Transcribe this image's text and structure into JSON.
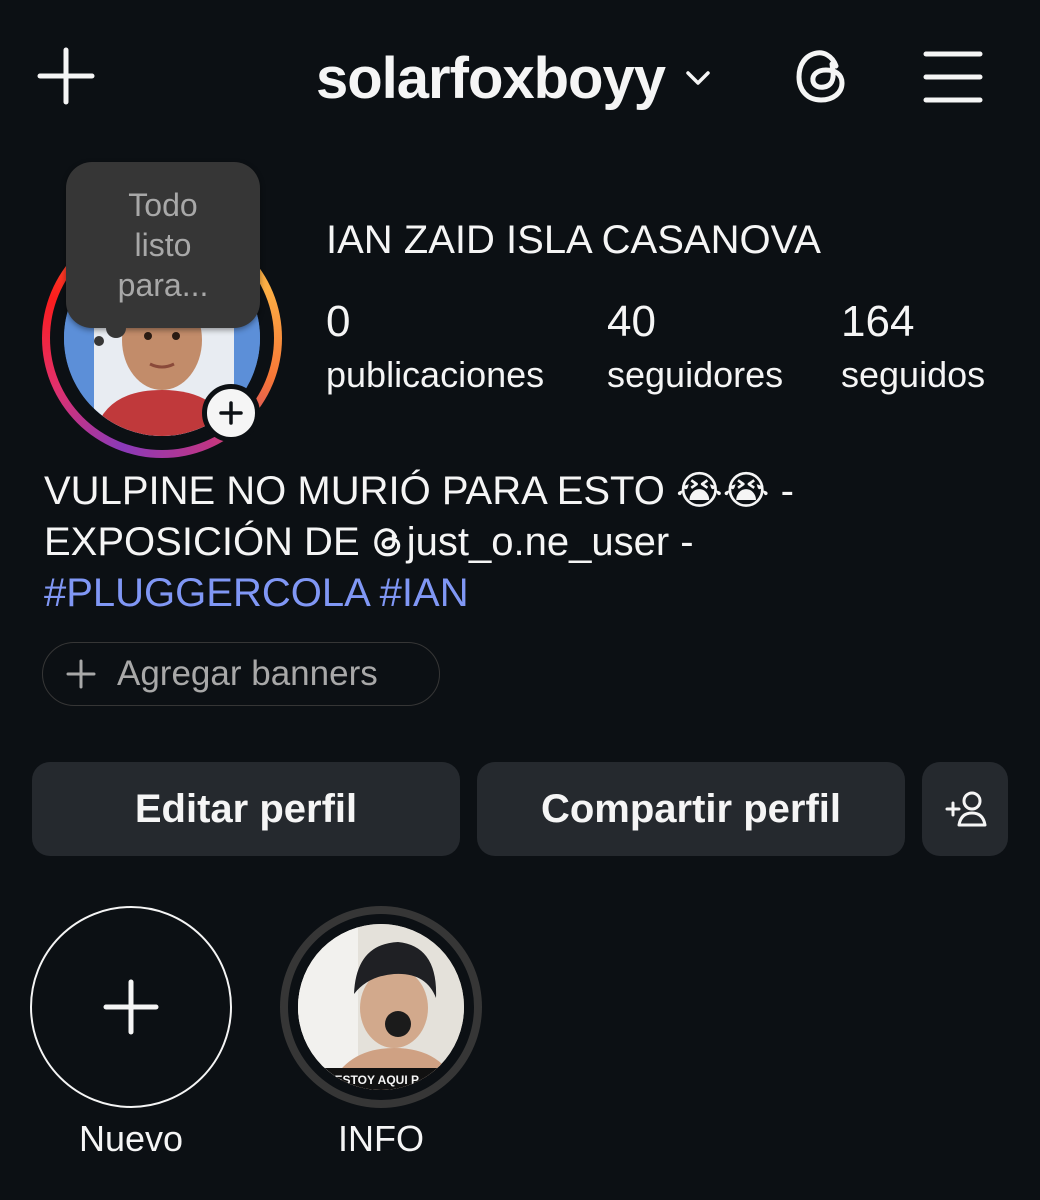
{
  "header": {
    "username": "solarfoxboyy",
    "icons": [
      "plus-icon",
      "chevron-down-icon",
      "threads-icon",
      "menu-icon"
    ]
  },
  "note": {
    "text": "Todo\nlisto\npara..."
  },
  "profile": {
    "full_name": "IAN ZAID ISLA CASANOVA",
    "stats": {
      "posts": {
        "value": "0",
        "label": "publicaciones"
      },
      "followers": {
        "value": "40",
        "label": "seguidores"
      },
      "following": {
        "value": "164",
        "label": "seguidos"
      }
    }
  },
  "bio": {
    "line1": "VULPINE NO MURIÓ PARA ESTO ",
    "line1_emoji": "😭😭",
    "line1_end": " -",
    "line2": "EXPOSICIÓN DE ",
    "line2_threads_mention": "just_o.ne_user -",
    "hashtags": "#PLUGGERCOLA #IAN"
  },
  "banner": {
    "label": "Agregar banners"
  },
  "actions": {
    "edit_label": "Editar perfil",
    "share_label": "Compartir perfil"
  },
  "highlights": [
    {
      "label": "Nuevo"
    },
    {
      "label": "INFO",
      "cover_text": "ESTOY AQUI P..."
    }
  ],
  "colors": {
    "background": "#0c1014",
    "button": "#25292e",
    "hashtag": "#8097f5",
    "muted_text": "#a8a8a8"
  }
}
